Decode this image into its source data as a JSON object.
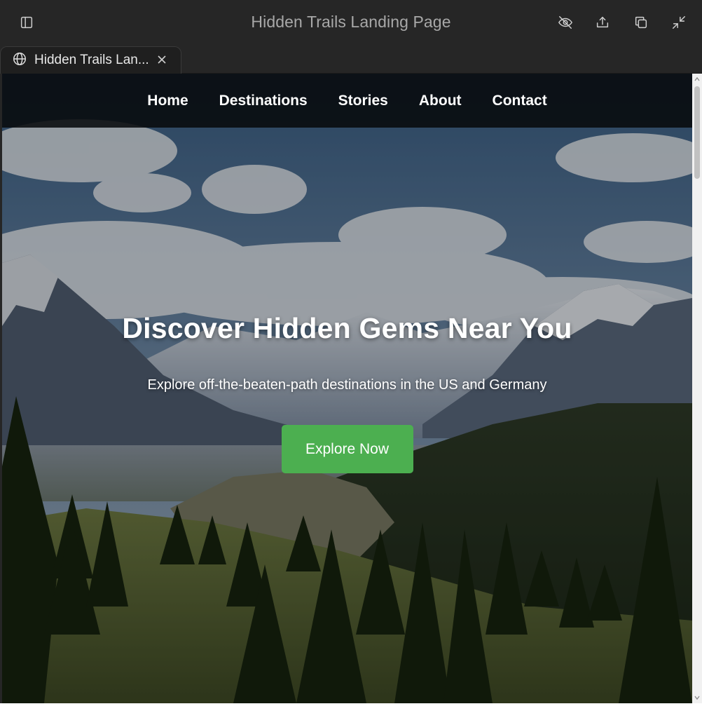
{
  "window": {
    "title": "Hidden Trails Landing Page",
    "icons": [
      "sidebar-toggle-icon",
      "eye-off-icon",
      "share-icon",
      "copy-icon",
      "minimize-icon"
    ]
  },
  "tab": {
    "label": "Hidden Trails Lan...",
    "icon": "globe-icon"
  },
  "nav": {
    "items": [
      {
        "label": "Home"
      },
      {
        "label": "Destinations"
      },
      {
        "label": "Stories"
      },
      {
        "label": "About"
      },
      {
        "label": "Contact"
      }
    ]
  },
  "hero": {
    "title": "Discover Hidden Gems Near You",
    "subtitle": "Explore off-the-beaten-path destinations in the US and Germany",
    "cta_label": "Explore Now"
  },
  "colors": {
    "accent": "#4caf50",
    "chrome": "#262626",
    "nav_bg": "#080a0c"
  }
}
